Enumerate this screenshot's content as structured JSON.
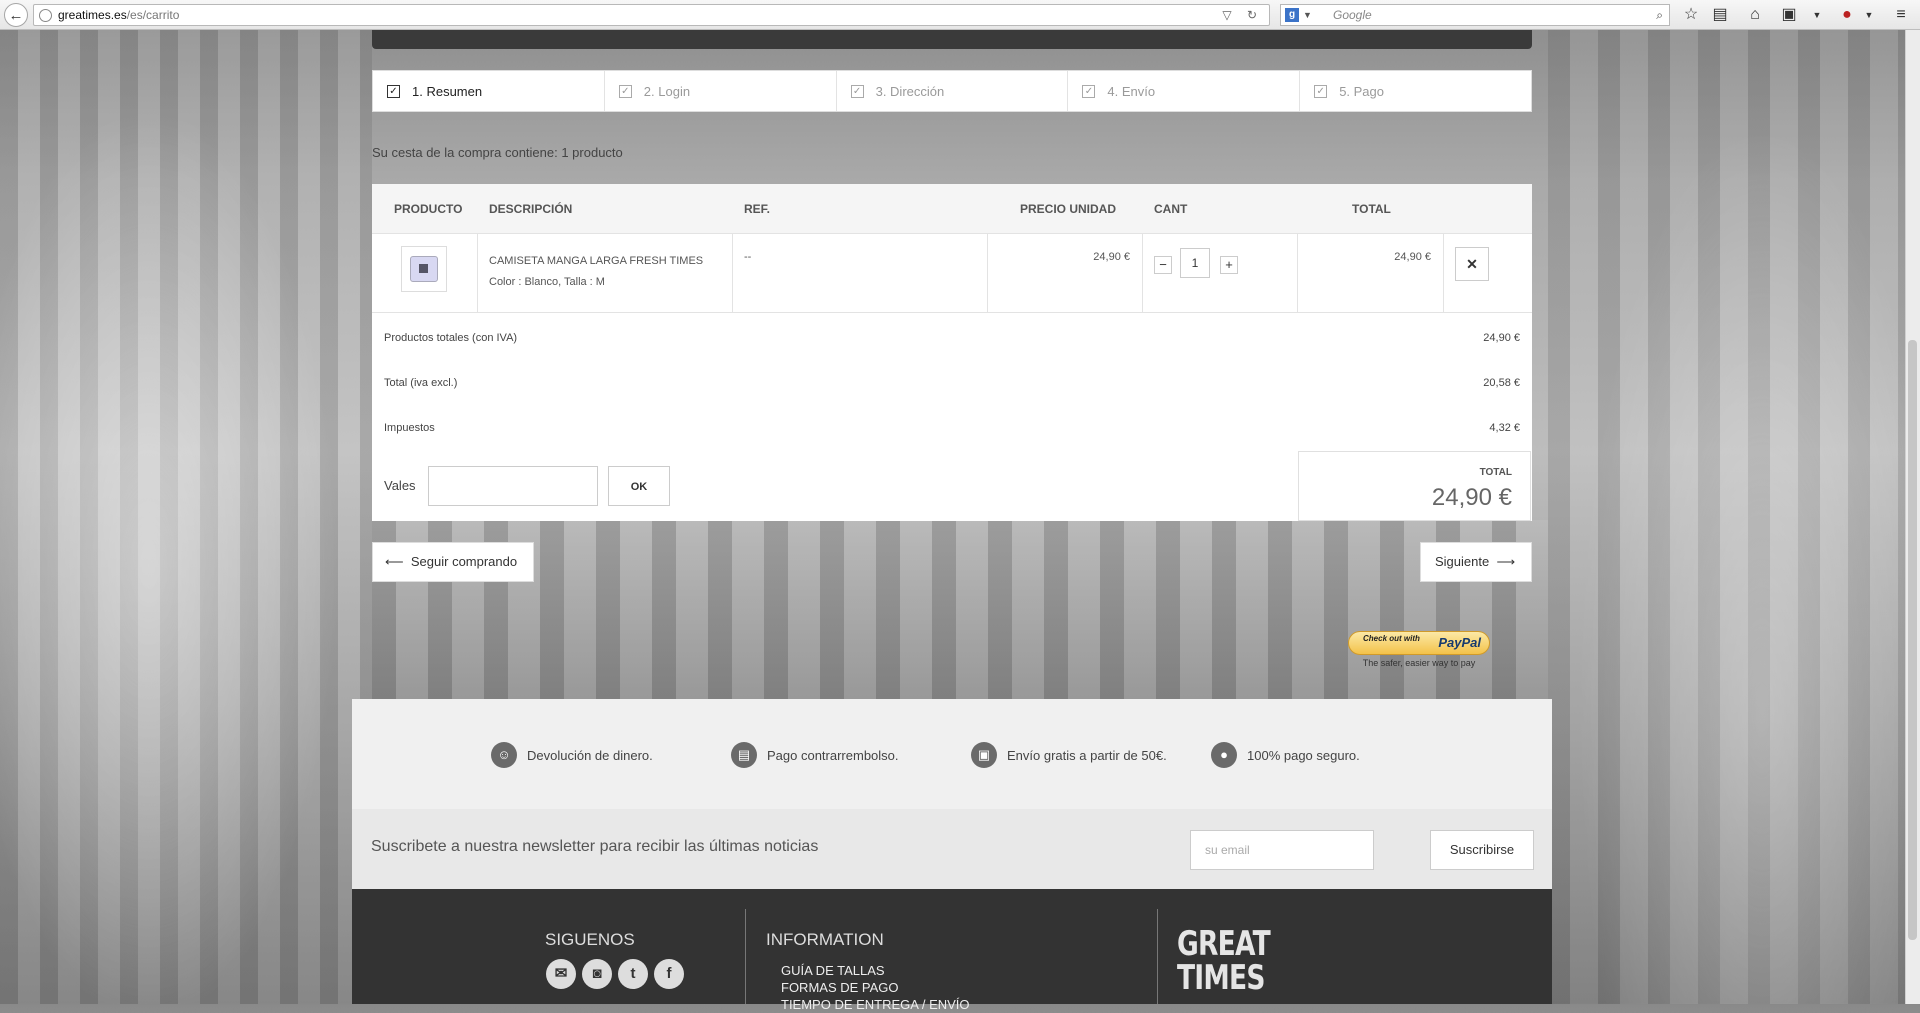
{
  "browser": {
    "url_host": "greatimes.es",
    "url_path": "/es/carrito",
    "url_controls": "▽ ↻",
    "search_placeholder": "Google",
    "search_engine_icon": "google-icon",
    "toolbar_icons": [
      "star-icon",
      "reading-list-icon",
      "home-icon",
      "addon-icon",
      "abp-icon",
      "menu-icon"
    ]
  },
  "checkout_steps": [
    {
      "label": "1. Resumen",
      "active": true
    },
    {
      "label": "2. Login",
      "active": false
    },
    {
      "label": "3. Dirección",
      "active": false
    },
    {
      "label": "4. Envío",
      "active": false
    },
    {
      "label": "5. Pago",
      "active": false
    }
  ],
  "cart": {
    "summary_text": "Su cesta de la compra contiene: 1 producto",
    "headers": {
      "product": "PRODUCTO",
      "description": "DESCRIPCIÓN",
      "ref": "REF.",
      "unit_price": "PRECIO UNIDAD",
      "qty": "CANT",
      "total": "TOTAL"
    },
    "item": {
      "name": "CAMISETA MANGA LARGA FRESH TIMES",
      "variant": "Color : Blanco, Talla : M",
      "ref": "--",
      "unit_price": "24,90 €",
      "qty": "1",
      "minus": "−",
      "plus": "+",
      "total": "24,90 €",
      "delete": "✕"
    },
    "totals": [
      {
        "label": "Productos totales (con IVA)",
        "value": "24,90 €"
      },
      {
        "label": "Total (iva excl.)",
        "value": "20,58 €"
      },
      {
        "label": "Impuestos",
        "value": "4,32 €"
      }
    ],
    "voucher": {
      "label": "Vales",
      "button": "OK"
    },
    "grand_total": {
      "label": "TOTAL",
      "value": "24,90 €"
    }
  },
  "nav": {
    "back_arrow": "⟵",
    "back": "Seguir comprando",
    "next": "Siguiente",
    "next_arrow": "⟶"
  },
  "paypal": {
    "check_out_with": "Check out with",
    "brand": "PayPal",
    "tagline": "The safer, easier way to pay"
  },
  "features": [
    {
      "icon": "smiley-icon",
      "glyph": "☺",
      "label": "Devolución de dinero."
    },
    {
      "icon": "cash-icon",
      "glyph": "▤",
      "label": "Pago contrarrembolso."
    },
    {
      "icon": "truck-icon",
      "glyph": "▣",
      "label": "Envío gratis a partir de 50€."
    },
    {
      "icon": "lock-icon",
      "glyph": "●",
      "label": "100% pago seguro."
    }
  ],
  "newsletter": {
    "text": "Suscribete a nuestra newsletter para recibir las últimas noticias",
    "placeholder": "su email",
    "button": "Suscribirse"
  },
  "footer": {
    "follow_heading": "SIGUENOS",
    "social": [
      {
        "icon": "email-icon",
        "glyph": "✉"
      },
      {
        "icon": "instagram-icon",
        "glyph": "◙"
      },
      {
        "icon": "twitter-icon",
        "glyph": "t"
      },
      {
        "icon": "facebook-icon",
        "glyph": "f"
      }
    ],
    "info_heading": "INFORMATION",
    "links": [
      "GUÍA DE TALLAS",
      "FORMAS DE PAGO",
      "TIEMPO DE ENTREGA / ENVÍO"
    ],
    "logo_line1": "GREAT",
    "logo_line2": "TIMES"
  }
}
